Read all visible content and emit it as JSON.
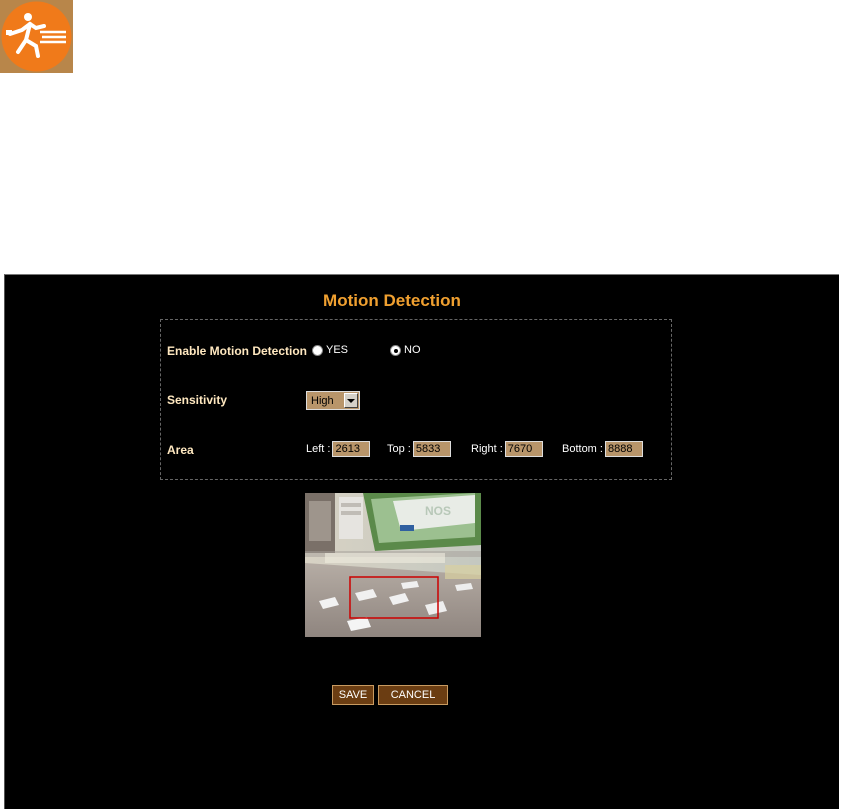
{
  "logo": {
    "icon": "motion-running-figure-icon"
  },
  "page": {
    "title": "Motion Detection"
  },
  "form": {
    "enable_label": "Enable Motion Detection",
    "enable_options": [
      {
        "label": "YES",
        "checked": false
      },
      {
        "label": "NO",
        "checked": true
      }
    ],
    "sensitivity_label": "Sensitivity",
    "sensitivity_value": "High",
    "area_label": "Area",
    "area": {
      "left_label": "Left :",
      "left_value": "2613",
      "top_label": "Top :",
      "top_value": "5833",
      "right_label": "Right :",
      "right_value": "7670",
      "bottom_label": "Bottom :",
      "bottom_value": "8888"
    }
  },
  "buttons": {
    "save": "SAVE",
    "cancel": "CANCEL"
  },
  "colors": {
    "title": "#f0a030",
    "panel_bg": "#000000",
    "input_bg": "#b8956a",
    "button_bg": "#6b3d12",
    "detection_box": "#cc0000"
  }
}
